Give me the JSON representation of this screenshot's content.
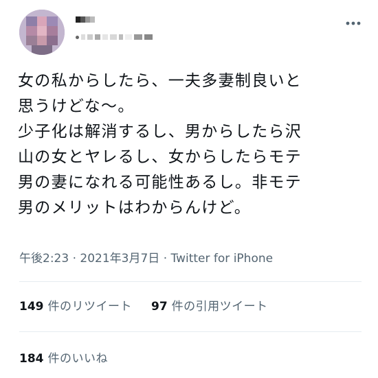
{
  "tweet": {
    "text": "女の私からしたら、一夫多妻制良いと\n思うけどな〜。\n少子化は解消するし、男からしたら沢\n山の女とヤレるし、女からしたらモテ\n男の妻になれる可能性あるし。非モテ\n男のメリットはわからんけど。",
    "time": "午後2:23",
    "separator1": "·",
    "date": "2021年3月7日",
    "separator2": "·",
    "source": "Twitter for iPhone"
  },
  "stats": {
    "retweets": {
      "count": "149",
      "label": "件のリツイート"
    },
    "quotes": {
      "count": "97",
      "label": "件の引用ツイート"
    },
    "likes": {
      "count": "184",
      "label": "件のいいね"
    }
  },
  "icons": {
    "more": "more-horizontal-icon",
    "avatar": "blurred-avatar"
  },
  "colors": {
    "text": "#0f1419",
    "secondary": "#536471",
    "divider": "#e6ecf0"
  }
}
